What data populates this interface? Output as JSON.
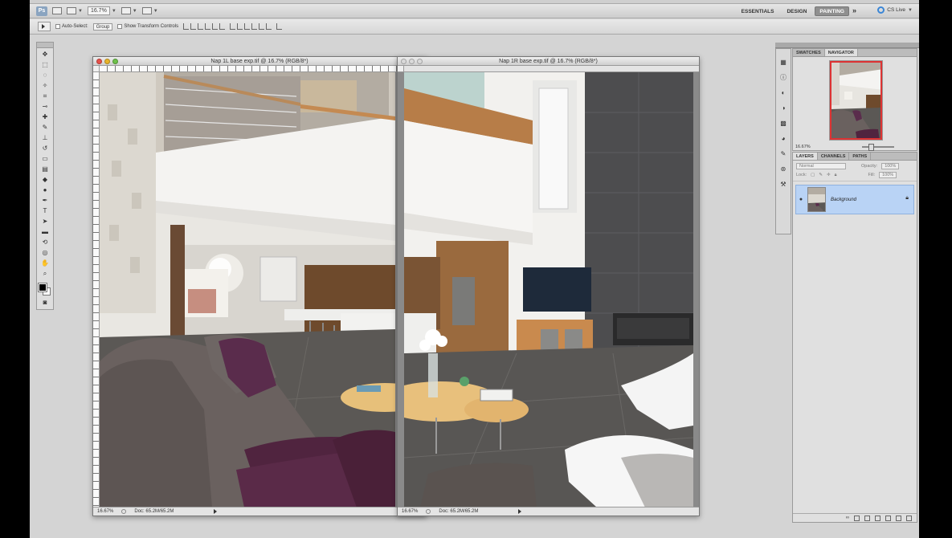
{
  "app": {
    "zoom_menu_value": "16.7%",
    "workspaces": [
      "ESSENTIALS",
      "DESIGN",
      "PAINTING"
    ],
    "active_workspace": "PAINTING",
    "more_label": "»",
    "cs_live_label": "CS Live"
  },
  "options_bar": {
    "auto_select_label": "Auto-Select:",
    "auto_select_value": "Group",
    "show_transform_label": "Show Transform Controls"
  },
  "documents": [
    {
      "title": "Nap 1L base exp.tif @ 16.7% (RGB/8*)",
      "zoom": "16.67%",
      "doc_size": "Doc: 65.2M/65.2M"
    },
    {
      "title": "Nap 1R base exp.tif @ 16.7% (RGB/8*)",
      "zoom": "16.67%",
      "doc_size": "Doc: 65.2M/65.2M"
    }
  ],
  "navigator_panel": {
    "tabs": [
      "SWATCHES",
      "NAVIGATOR"
    ],
    "active_tab": "NAVIGATOR",
    "zoom": "16.67%"
  },
  "layers_panel": {
    "tabs": [
      "LAYERS",
      "CHANNELS",
      "PATHS"
    ],
    "active_tab": "LAYERS",
    "blend_mode": "Normal",
    "opacity_label": "Opacity:",
    "opacity_value": "100%",
    "lock_label": "Lock:",
    "fill_label": "Fill:",
    "fill_value": "100%",
    "layers": [
      {
        "name": "Background"
      }
    ]
  },
  "colors": {
    "workspace_bg": "#d4d4d4",
    "selected_layer": "#b9d3f5",
    "navigator_view_box": "#dd3333",
    "cs_live_accent": "#3a86d6"
  },
  "icons": {
    "toolbox": [
      "move-icon",
      "marquee-icon",
      "lasso-icon",
      "quick-select-icon",
      "crop-icon",
      "eyedropper-icon",
      "healing-icon",
      "brush-icon",
      "clone-stamp-icon",
      "history-brush-icon",
      "eraser-icon",
      "gradient-icon",
      "blur-icon",
      "dodge-icon",
      "pen-icon",
      "type-icon",
      "path-select-icon",
      "shape-icon",
      "3d-rotate-icon",
      "3d-orbit-icon",
      "hand-icon",
      "zoom-icon",
      "quick-mask-icon"
    ],
    "panel_strip": [
      "histogram-icon",
      "info-icon",
      "adjustments-icon",
      "masks-icon",
      "styles-icon",
      "color-icon",
      "brush-presets-icon",
      "clone-source-icon",
      "tool-presets-icon"
    ]
  }
}
